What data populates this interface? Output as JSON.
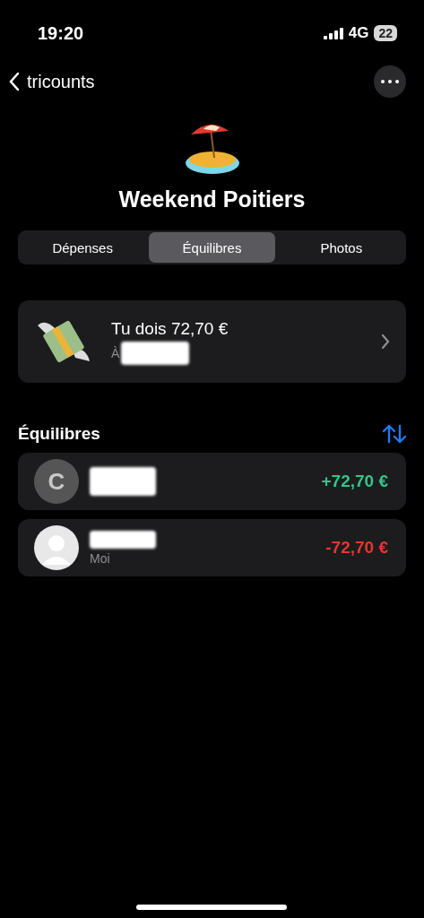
{
  "status_bar": {
    "time": "19:20",
    "network": "4G",
    "battery": "22"
  },
  "nav": {
    "back_label": "tricounts"
  },
  "group": {
    "title": "Weekend Poitiers"
  },
  "tabs": [
    {
      "label": "Dépenses",
      "selected": false
    },
    {
      "label": "Équilibres",
      "selected": true
    },
    {
      "label": "Photos",
      "selected": false
    }
  ],
  "debt_card": {
    "title": "Tu dois 72,70 €",
    "subtitle": "À"
  },
  "section": {
    "title": "Équilibres"
  },
  "balances": [
    {
      "kind": "initial",
      "initial": "C",
      "amount": "+72,70 €",
      "color": "#34c48a"
    },
    {
      "kind": "silhouette",
      "subtitle": "Moi",
      "amount": "-72,70 €",
      "color": "#e0392f"
    }
  ]
}
